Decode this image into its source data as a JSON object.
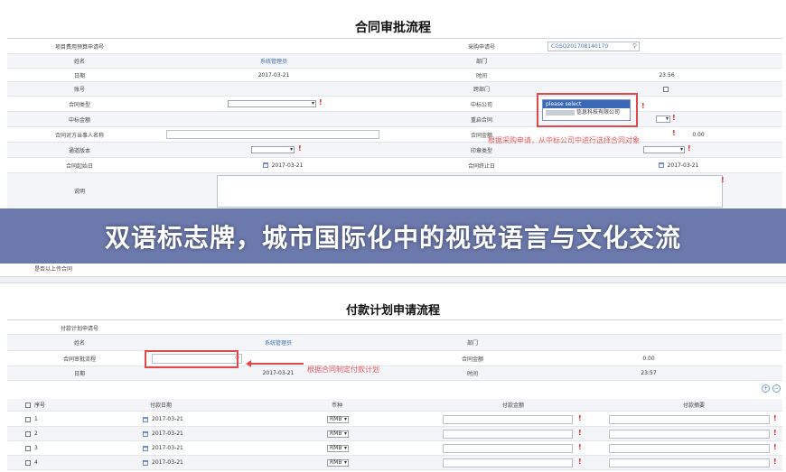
{
  "contract": {
    "title": "合同审批流程",
    "fields": {
      "project_no_label": "项目费用预算申请号",
      "purchase_no_label": "采购申请号",
      "purchase_no_value": "CGSQ201708140170",
      "name_label": "姓名",
      "name_value": "系统管理员",
      "dept_label": "部门",
      "date_label": "日期",
      "date_value": "2017-03-21",
      "time_label": "时间",
      "time_value": "23:56",
      "account_label": "账号",
      "cross_dept_label": "跨部门",
      "type_label": "合同类型",
      "bid_company_label": "中标公司",
      "bid_amount_label": "中标金额",
      "renew_label": "重启合同",
      "counterparty_label": "合同对方当事人名称",
      "contract_amount_label": "合同金额",
      "contract_amount_value": "0.00",
      "template_label": "通道版本",
      "seal_label": "印章类型",
      "start_label": "合同起始日",
      "start_value": "2017-03-21",
      "end_label": "合同终止日",
      "end_value": "2017-03-21",
      "desc_label": "说明",
      "last_label": "是否以上传合同"
    },
    "dropdown": {
      "placeholder": "please select",
      "option_suffix": "信息科技有限公司"
    },
    "hint": "根据采购申请，从中标公司中进行选择合同对象"
  },
  "banner": {
    "text": "双语标志牌，城市国际化中的视觉语言与文化交流"
  },
  "payment": {
    "title": "付款计划申请流程",
    "fields": {
      "plan_no_label": "付款计划申请号",
      "name_label": "姓名",
      "name_value": "系统管理员",
      "dept_label": "部门",
      "contract_flow_label": "合同审批流程",
      "contract_amount_label": "合同金额",
      "contract_amount_value": "0.00",
      "date_label": "日期",
      "date_value": "2017-03-21",
      "time_label": "时间",
      "time_value": "23:57"
    },
    "hint": "根据合同制定付款计划",
    "table": {
      "headers": [
        "序号",
        "付款日期",
        "币种",
        "付款金额",
        "付款摘要"
      ],
      "rows": [
        {
          "no": "1",
          "date": "2017-03-21",
          "currency": "RMB"
        },
        {
          "no": "2",
          "date": "2017-03-21",
          "currency": "RMB"
        },
        {
          "no": "3",
          "date": "2017-03-21",
          "currency": "RMB"
        },
        {
          "no": "4",
          "date": "2017-03-21",
          "currency": "RMB"
        }
      ]
    }
  },
  "colors": {
    "banner": "#5867a2",
    "accent_red": "#e0484c",
    "link": "#3f6fb5"
  }
}
